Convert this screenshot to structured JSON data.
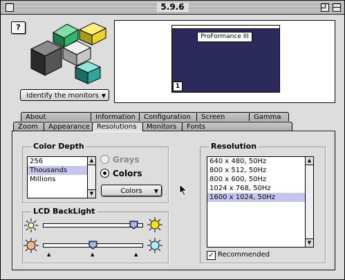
{
  "window": {
    "title": "5.9.6"
  },
  "help_button": {
    "label": "?"
  },
  "identify_button": {
    "label": "Identify the monitors"
  },
  "preview": {
    "monitor_name": "ProFormance III",
    "monitor_number": "1"
  },
  "tabs_row1": [
    "About ProGraphics",
    "Information",
    "Configuration",
    "Screen saver",
    "Gamma"
  ],
  "tabs_row2": [
    "Zoom",
    "Appearance",
    "Resolutions",
    "Monitors",
    "Fonts"
  ],
  "active_tab": "Resolutions",
  "color_depth": {
    "title": "Color Depth",
    "items": [
      "256",
      "Thousands",
      "Millions"
    ],
    "selected": "Thousands",
    "radio_grays": "Grays",
    "radio_colors": "Colors",
    "popup_label": "Colors"
  },
  "lcd_backlight": {
    "title": "LCD BackLight",
    "brightness_level": 0.92,
    "temperature_level": 0.51
  },
  "resolution": {
    "title": "Resolution",
    "items": [
      "640 x 480, 50Hz",
      "800 x 512, 50Hz",
      "800 x 600, 50Hz",
      "1024 x 768, 50Hz",
      "1600 x 1024, 50Hz"
    ],
    "selected": "1600 x 1024, 50Hz",
    "recommended_label": "Recommended",
    "recommended_checked": true
  },
  "colors": {
    "selection": "#c5c5ee",
    "preview_screen": "#2c2a5a"
  }
}
